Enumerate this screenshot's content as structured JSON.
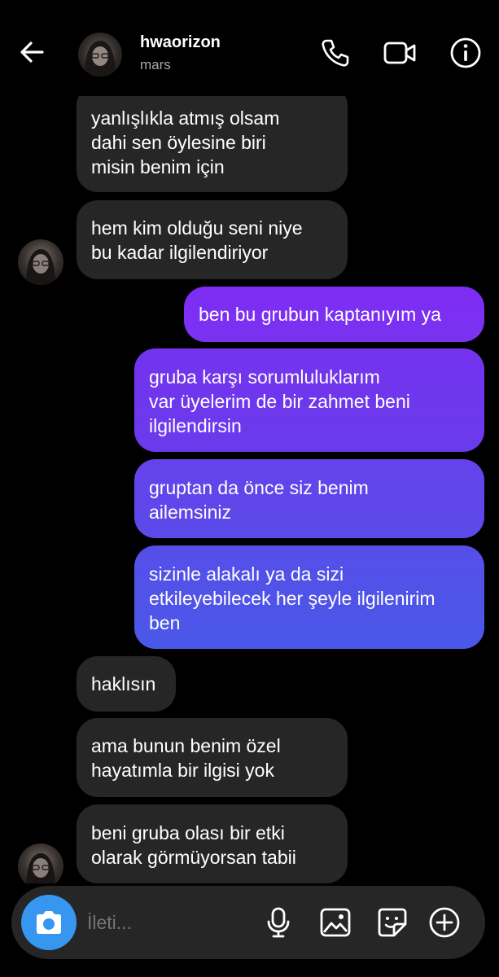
{
  "header": {
    "name": "hwaorizon",
    "subtitle": "mars"
  },
  "messages": [
    {
      "side": "in",
      "text": "yanlışlıkla atmış olsam\ndahi sen öylesine biri\nmisin benim için"
    },
    {
      "side": "in",
      "text": "hem kim olduğu seni niye\nbu kadar ilgilendiriyor"
    },
    {
      "side": "out",
      "text": "ben bu grubun kaptanıyım ya"
    },
    {
      "side": "out",
      "text": "gruba karşı sorumluluklarım\nvar üyelerim de bir zahmet beni\nilgilendirsin"
    },
    {
      "side": "out",
      "text": "gruptan da önce siz benim\nailemsiniz"
    },
    {
      "side": "out",
      "text": "sizinle alakalı ya da sizi\netkileyebilecek her şeyle ilgilenirim\nben"
    },
    {
      "side": "in",
      "text": "haklısın"
    },
    {
      "side": "in",
      "text": "ama bunun benim özel\nhayatımla bir ilgisi yok"
    },
    {
      "side": "in",
      "text": "beni gruba olası bir etki\nolarak görmüyorsan tabii"
    }
  ],
  "composer": {
    "placeholder": "İleti..."
  },
  "colors": {
    "gradient_top": "#7c2ff0",
    "gradient_bottom": "#4757e8",
    "incoming": "#262626",
    "camera": "#3797f0"
  },
  "icons": [
    "back-arrow-icon",
    "phone-icon",
    "video-camera-icon",
    "info-icon",
    "camera-icon",
    "microphone-icon",
    "gallery-icon",
    "sticker-icon",
    "plus-icon"
  ]
}
